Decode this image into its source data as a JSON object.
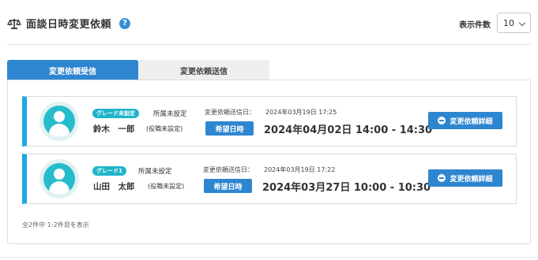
{
  "header": {
    "title": "面談日時変更依頼",
    "help": "?",
    "per_page_label": "表示件数",
    "per_page_value": "10"
  },
  "tabs": [
    {
      "label": "変更依頼受信",
      "active": true
    },
    {
      "label": "変更依頼送信",
      "active": false
    }
  ],
  "requests": [
    {
      "grade": "グレード未設定",
      "department": "所属未設定",
      "name": "鈴木　一郎",
      "role": "(役職未設定)",
      "sent_label": "変更依頼送信日：",
      "sent_at": "2024年03月19日 17:25",
      "want_label": "希望日時",
      "datetime": "2024年04月02日 14:00 - 14:30",
      "detail_label": "変更依頼詳細"
    },
    {
      "grade": "グレード1",
      "department": "所属未設定",
      "name": "山田　太郎",
      "role": "(役職未設定)",
      "sent_label": "変更依頼送信日：",
      "sent_at": "2024年03月19日 17:22",
      "want_label": "希望日時",
      "datetime": "2024年03月27日 10:00 - 10:30",
      "detail_label": "変更依頼詳細"
    }
  ],
  "footer": {
    "count_text": "全2件中 1-2件目を表示"
  },
  "colors": {
    "primary": "#2f86d0",
    "accent": "#1ca9e1",
    "grade": "#1fb4c9",
    "avatar": "#26bccc"
  },
  "icons": {
    "title": "scale-icon",
    "help": "question-icon",
    "avatar": "user-icon",
    "detail": "minus-circle-icon"
  }
}
